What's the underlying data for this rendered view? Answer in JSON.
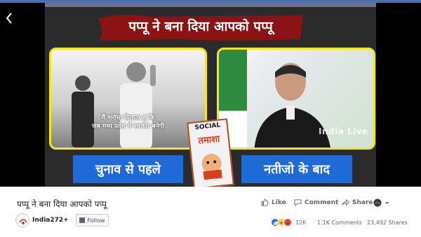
{
  "video": {
    "banner_text": "पप्पू ने बना दिया आपको पप्पू",
    "left_caption_line1": "मैं भरोसा दिलाता हूं कि",
    "left_caption_line2": "जब मध्य प्रदेश में सरकार बनेगी",
    "right_watermark": "India Live",
    "label_left": "चुनाव से पहले",
    "label_right": "नतीजो के बाद",
    "sticker_top": "SOCIAL",
    "sticker_mid": "तमाशा"
  },
  "post": {
    "title": "पप्पू ने बना दिया आपको पप्पू",
    "page_name": "India272+",
    "follow_label": "Follow"
  },
  "actions": {
    "like": "Like",
    "comment": "Comment",
    "share": "Share"
  },
  "stats": {
    "reactions": "12K",
    "comments": "1.1K Comments",
    "shares": "23,492 Shares"
  },
  "colors": {
    "label_blue": "#1f6ad6",
    "panel_border": "#f3e51f",
    "banner_red": "#8b1313",
    "facebook_blue": "#1877f2"
  }
}
